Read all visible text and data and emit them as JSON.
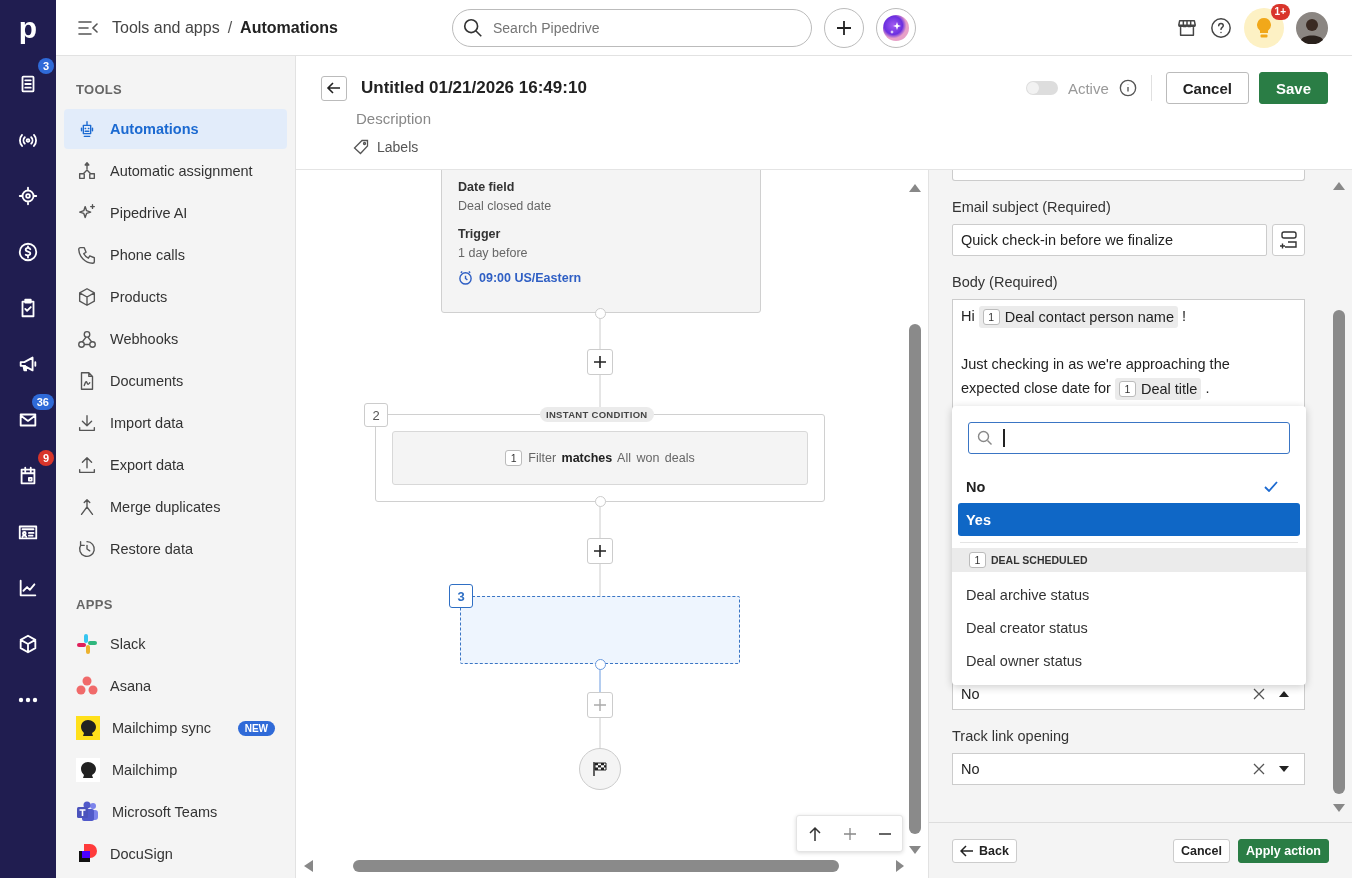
{
  "rail": {
    "logo": "p",
    "items": [
      {
        "selected": false,
        "badge": "3",
        "color": "#2f6ad8"
      },
      {
        "selected": false
      },
      {
        "selected": false
      },
      {
        "selected": false
      },
      {
        "selected": false
      },
      {
        "selected": false
      },
      {
        "selected": false,
        "badge": "36",
        "color": "#2f6ad8"
      },
      {
        "selected": false,
        "badge": "9",
        "color": "#d9352b"
      },
      {
        "selected": false
      },
      {
        "selected": false
      },
      {
        "selected": false
      },
      {
        "selected": false
      }
    ]
  },
  "topbar": {
    "breadcrumb": [
      "Tools and apps",
      "/",
      "Automations"
    ],
    "search": {
      "placeholder": "Search Pipedrive"
    },
    "notification_badge": "1+"
  },
  "sidebar": {
    "sections": [
      {
        "title": "TOOLS",
        "items": [
          {
            "label": "Automations",
            "selected": true
          },
          {
            "label": "Automatic assignment",
            "selected": false
          },
          {
            "label": "Pipedrive AI",
            "selected": false
          },
          {
            "label": "Phone calls",
            "selected": false
          },
          {
            "label": "Products",
            "selected": false
          },
          {
            "label": "Webhooks",
            "selected": false
          },
          {
            "label": "Documents",
            "selected": false
          },
          {
            "label": "Import data",
            "selected": false
          },
          {
            "label": "Export data",
            "selected": false
          },
          {
            "label": "Merge duplicates",
            "selected": false
          },
          {
            "label": "Restore data",
            "selected": false
          }
        ]
      },
      {
        "title": "APPS",
        "items": [
          {
            "label": "Slack",
            "selected": false
          },
          {
            "label": "Asana",
            "selected": false
          },
          {
            "label": "Mailchimp sync",
            "selected": false,
            "badge": "NEW"
          },
          {
            "label": "Mailchimp",
            "selected": false
          },
          {
            "label": "Microsoft Teams",
            "selected": false
          },
          {
            "label": "DocuSign",
            "selected": false
          }
        ]
      }
    ]
  },
  "header": {
    "title": "Untitled 01/21/2026 16:49:10",
    "description": "Description",
    "labels": "Labels",
    "active": {
      "label": "Active",
      "on": false
    },
    "buttons": [
      "Cancel",
      "Save"
    ]
  },
  "canvas": {
    "trigger": {
      "fields": [
        {
          "label": "Date field",
          "value": "Deal closed date"
        },
        {
          "label": "Trigger",
          "value": "1 day before"
        }
      ],
      "time": "09:00 US/Eastern"
    },
    "condition": {
      "number": "2",
      "tag": "INSTANT CONDITION",
      "filter": {
        "step": "1",
        "text": "Filter **matches** All won deals"
      }
    },
    "placeholder_step": {
      "number": "3",
      "selected": true
    }
  },
  "panel": {
    "email_subject": {
      "label": "Email subject (Required)",
      "value": "Quick check-in before we finalize"
    },
    "body": {
      "label": "Body (Required)",
      "paragraphs": [
        [
          {
            "kind": "text",
            "text": "Hi"
          },
          {
            "kind": "chip",
            "step": "1",
            "text": "Deal contact person name"
          },
          {
            "kind": "text",
            "text": "!"
          }
        ],
        [
          {
            "kind": "text",
            "text": "Just checking in as we're approaching the"
          },
          {
            "kind": "text",
            "text": "expected close date for"
          },
          {
            "kind": "chip",
            "step": "1",
            "text": "Deal title"
          },
          {
            "kind": "text",
            "text": "."
          }
        ]
      ]
    },
    "dropdown": {
      "options": [
        {
          "label": "No",
          "selected": true,
          "highlighted": false
        },
        {
          "label": "Yes",
          "selected": false,
          "highlighted": true
        }
      ],
      "group": {
        "step": "1",
        "title": "DEAL SCHEDULED",
        "options": [
          {
            "label": "Deal archive status",
            "selected": false,
            "highlighted": false
          },
          {
            "label": "Deal creator status",
            "selected": false,
            "highlighted": false
          },
          {
            "label": "Deal owner status",
            "selected": false,
            "highlighted": false
          }
        ]
      }
    },
    "selects": [
      {
        "value": "No",
        "open": true
      },
      {
        "label": "Track link opening",
        "value": "No",
        "open": false
      }
    ],
    "footer": {
      "back": "Back",
      "cancel": "Cancel",
      "apply": "Apply action"
    }
  }
}
